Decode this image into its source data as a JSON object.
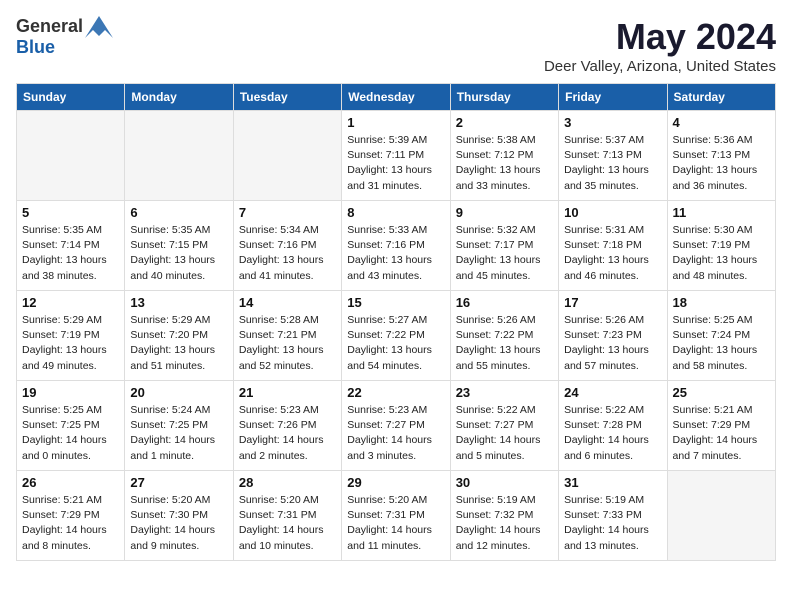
{
  "header": {
    "logo_general": "General",
    "logo_blue": "Blue",
    "main_title": "May 2024",
    "subtitle": "Deer Valley, Arizona, United States"
  },
  "weekdays": [
    "Sunday",
    "Monday",
    "Tuesday",
    "Wednesday",
    "Thursday",
    "Friday",
    "Saturday"
  ],
  "weeks": [
    [
      {
        "day": "",
        "info": ""
      },
      {
        "day": "",
        "info": ""
      },
      {
        "day": "",
        "info": ""
      },
      {
        "day": "1",
        "info": "Sunrise: 5:39 AM\nSunset: 7:11 PM\nDaylight: 13 hours\nand 31 minutes."
      },
      {
        "day": "2",
        "info": "Sunrise: 5:38 AM\nSunset: 7:12 PM\nDaylight: 13 hours\nand 33 minutes."
      },
      {
        "day": "3",
        "info": "Sunrise: 5:37 AM\nSunset: 7:13 PM\nDaylight: 13 hours\nand 35 minutes."
      },
      {
        "day": "4",
        "info": "Sunrise: 5:36 AM\nSunset: 7:13 PM\nDaylight: 13 hours\nand 36 minutes."
      }
    ],
    [
      {
        "day": "5",
        "info": "Sunrise: 5:35 AM\nSunset: 7:14 PM\nDaylight: 13 hours\nand 38 minutes."
      },
      {
        "day": "6",
        "info": "Sunrise: 5:35 AM\nSunset: 7:15 PM\nDaylight: 13 hours\nand 40 minutes."
      },
      {
        "day": "7",
        "info": "Sunrise: 5:34 AM\nSunset: 7:16 PM\nDaylight: 13 hours\nand 41 minutes."
      },
      {
        "day": "8",
        "info": "Sunrise: 5:33 AM\nSunset: 7:16 PM\nDaylight: 13 hours\nand 43 minutes."
      },
      {
        "day": "9",
        "info": "Sunrise: 5:32 AM\nSunset: 7:17 PM\nDaylight: 13 hours\nand 45 minutes."
      },
      {
        "day": "10",
        "info": "Sunrise: 5:31 AM\nSunset: 7:18 PM\nDaylight: 13 hours\nand 46 minutes."
      },
      {
        "day": "11",
        "info": "Sunrise: 5:30 AM\nSunset: 7:19 PM\nDaylight: 13 hours\nand 48 minutes."
      }
    ],
    [
      {
        "day": "12",
        "info": "Sunrise: 5:29 AM\nSunset: 7:19 PM\nDaylight: 13 hours\nand 49 minutes."
      },
      {
        "day": "13",
        "info": "Sunrise: 5:29 AM\nSunset: 7:20 PM\nDaylight: 13 hours\nand 51 minutes."
      },
      {
        "day": "14",
        "info": "Sunrise: 5:28 AM\nSunset: 7:21 PM\nDaylight: 13 hours\nand 52 minutes."
      },
      {
        "day": "15",
        "info": "Sunrise: 5:27 AM\nSunset: 7:22 PM\nDaylight: 13 hours\nand 54 minutes."
      },
      {
        "day": "16",
        "info": "Sunrise: 5:26 AM\nSunset: 7:22 PM\nDaylight: 13 hours\nand 55 minutes."
      },
      {
        "day": "17",
        "info": "Sunrise: 5:26 AM\nSunset: 7:23 PM\nDaylight: 13 hours\nand 57 minutes."
      },
      {
        "day": "18",
        "info": "Sunrise: 5:25 AM\nSunset: 7:24 PM\nDaylight: 13 hours\nand 58 minutes."
      }
    ],
    [
      {
        "day": "19",
        "info": "Sunrise: 5:25 AM\nSunset: 7:25 PM\nDaylight: 14 hours\nand 0 minutes."
      },
      {
        "day": "20",
        "info": "Sunrise: 5:24 AM\nSunset: 7:25 PM\nDaylight: 14 hours\nand 1 minute."
      },
      {
        "day": "21",
        "info": "Sunrise: 5:23 AM\nSunset: 7:26 PM\nDaylight: 14 hours\nand 2 minutes."
      },
      {
        "day": "22",
        "info": "Sunrise: 5:23 AM\nSunset: 7:27 PM\nDaylight: 14 hours\nand 3 minutes."
      },
      {
        "day": "23",
        "info": "Sunrise: 5:22 AM\nSunset: 7:27 PM\nDaylight: 14 hours\nand 5 minutes."
      },
      {
        "day": "24",
        "info": "Sunrise: 5:22 AM\nSunset: 7:28 PM\nDaylight: 14 hours\nand 6 minutes."
      },
      {
        "day": "25",
        "info": "Sunrise: 5:21 AM\nSunset: 7:29 PM\nDaylight: 14 hours\nand 7 minutes."
      }
    ],
    [
      {
        "day": "26",
        "info": "Sunrise: 5:21 AM\nSunset: 7:29 PM\nDaylight: 14 hours\nand 8 minutes."
      },
      {
        "day": "27",
        "info": "Sunrise: 5:20 AM\nSunset: 7:30 PM\nDaylight: 14 hours\nand 9 minutes."
      },
      {
        "day": "28",
        "info": "Sunrise: 5:20 AM\nSunset: 7:31 PM\nDaylight: 14 hours\nand 10 minutes."
      },
      {
        "day": "29",
        "info": "Sunrise: 5:20 AM\nSunset: 7:31 PM\nDaylight: 14 hours\nand 11 minutes."
      },
      {
        "day": "30",
        "info": "Sunrise: 5:19 AM\nSunset: 7:32 PM\nDaylight: 14 hours\nand 12 minutes."
      },
      {
        "day": "31",
        "info": "Sunrise: 5:19 AM\nSunset: 7:33 PM\nDaylight: 14 hours\nand 13 minutes."
      },
      {
        "day": "",
        "info": ""
      }
    ]
  ]
}
